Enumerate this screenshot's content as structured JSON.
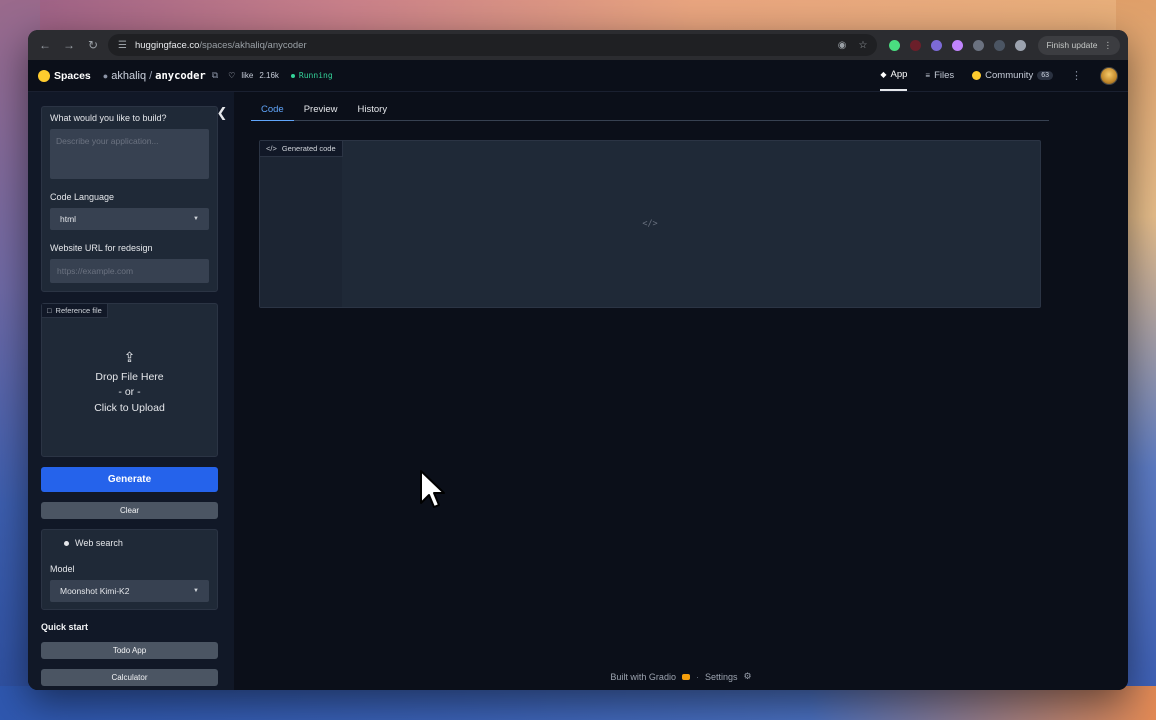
{
  "browser": {
    "url_host": "huggingface.co",
    "url_path": "/spaces/akhaliq/anycoder",
    "finish_update": "Finish update"
  },
  "hf": {
    "spaces_label": "Spaces",
    "owner": "akhaliq",
    "separator": "/",
    "repo": "anycoder",
    "like_label": "like",
    "like_count": "2.16k",
    "status": "Running",
    "tabs": [
      {
        "label": "App",
        "active": true
      },
      {
        "label": "Files",
        "active": false
      },
      {
        "label": "Community",
        "badge": "63",
        "active": false
      }
    ]
  },
  "sidebar": {
    "build_label": "What would you like to build?",
    "build_placeholder": "Describe your application...",
    "lang_label": "Code Language",
    "lang_value": "html",
    "url_label": "Website URL for redesign",
    "url_placeholder": "https://example.com",
    "reference_file": "Reference file",
    "drop_file": "Drop File Here",
    "or": "- or -",
    "click_upload": "Click to Upload",
    "generate": "Generate",
    "clear": "Clear",
    "web_search": "Web search",
    "model_label": "Model",
    "model_value": "Moonshot Kimi-K2",
    "quick_start": "Quick start",
    "quick_items": [
      "Todo App",
      "Calculator"
    ]
  },
  "content": {
    "tabs": [
      {
        "label": "Code",
        "active": true
      },
      {
        "label": "Preview",
        "active": false
      },
      {
        "label": "History",
        "active": false
      }
    ],
    "generated_code": "Generated code",
    "placeholder_icon": "</>"
  },
  "footer": {
    "built_with": "Built with Gradio",
    "settings": "Settings"
  }
}
